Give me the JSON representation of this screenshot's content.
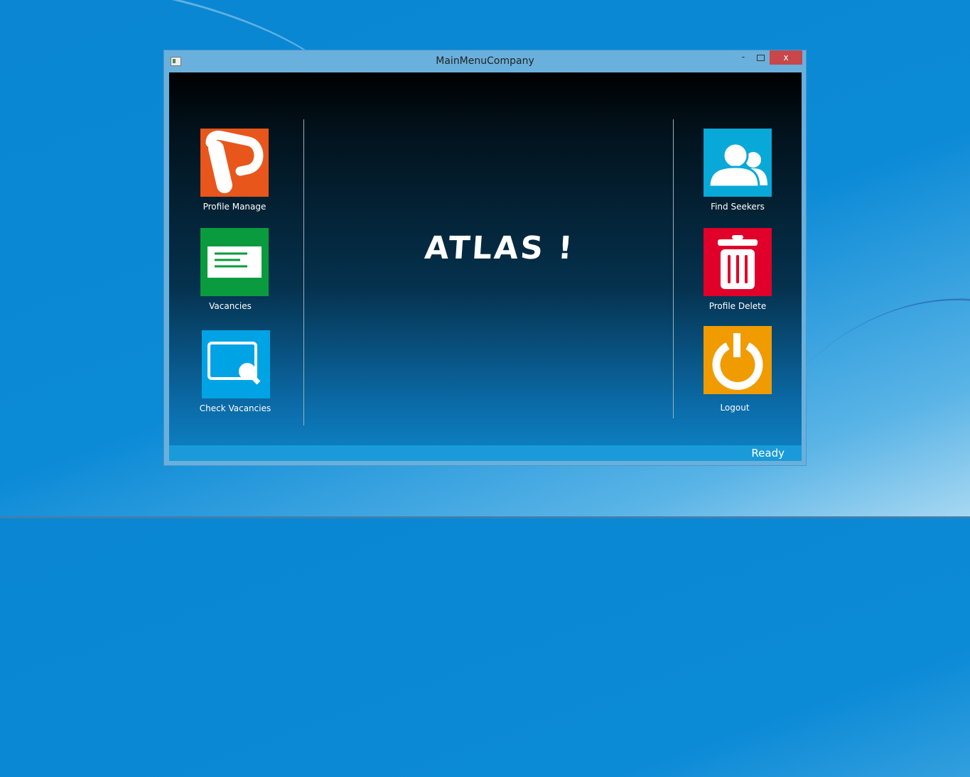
{
  "window": {
    "title": "MainMenuCompany",
    "minimize": "-",
    "close": "x"
  },
  "left_tiles": [
    {
      "label": "Profile Manage",
      "color": "#e8561c",
      "icon": "powerpoint-p-icon"
    },
    {
      "label": "Vacancies",
      "color": "#0a9b3e",
      "icon": "document-lines-icon"
    },
    {
      "label": "Check Vacancies",
      "color": "#00a4e4",
      "icon": "screen-search-icon"
    }
  ],
  "right_tiles": [
    {
      "label": "Find Seekers",
      "color": "#08a8d8",
      "icon": "users-icon"
    },
    {
      "label": "Profile Delete",
      "color": "#e0002a",
      "icon": "trash-icon"
    },
    {
      "label": "Logout",
      "color": "#f09b00",
      "icon": "power-icon"
    }
  ],
  "heading": "ATLAS !",
  "status": "Ready"
}
